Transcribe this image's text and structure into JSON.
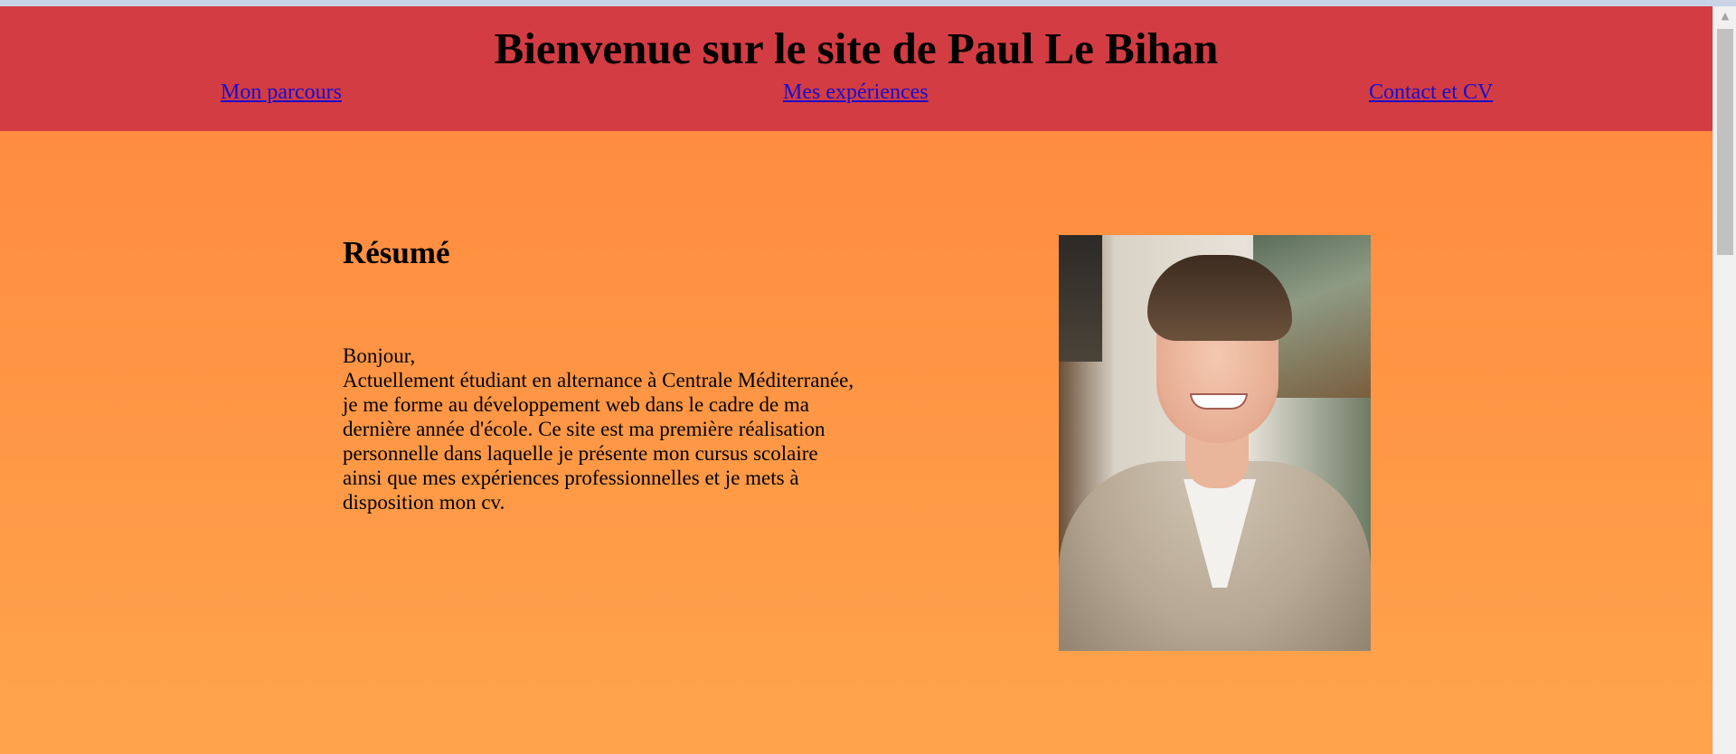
{
  "header": {
    "title": "Bienvenue sur le site de Paul Le Bihan",
    "nav": [
      {
        "label": "Mon parcours"
      },
      {
        "label": "Mes expériences"
      },
      {
        "label": "Contact et CV"
      }
    ]
  },
  "main": {
    "section_title": "Résumé",
    "bio_lines": [
      "Bonjour,",
      "Actuellement étudiant en alternance à Centrale Méditerranée,",
      "je me forme au développement web dans le cadre de ma",
      "dernière année d'école. Ce site est ma première réalisation",
      "personnelle dans laquelle je présente mon cursus scolaire",
      "ainsi que mes expériences professionnelles et je mets à",
      "disposition mon cv."
    ]
  },
  "colors": {
    "header_bg": "#d23c42",
    "main_bg_top": "#ff8c3f",
    "main_bg_bottom": "#ffa44d",
    "link": "#1a0dcc"
  },
  "icons": {
    "scroll_up": "scroll-up-arrow-icon"
  },
  "scrollbar": {
    "up_glyph": "▲"
  }
}
